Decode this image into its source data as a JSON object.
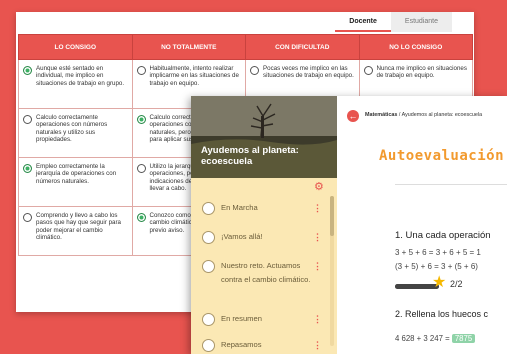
{
  "role_tabs": [
    "Docente",
    "Estudiante"
  ],
  "rubric": {
    "headers": [
      "Lo consigo",
      "No totalmente",
      "Con dificultad",
      "No lo consigo"
    ],
    "rows": [
      {
        "cells": [
          "Aunque esté sentado en individual, me implico en situaciones de trabajo en grupo.",
          "Habitualmente, intento realizar implicarme en las situaciones de trabajo en equipo.",
          "Pocas veces me implico en las situaciones de trabajo en equipo.",
          "Nunca me implico en situaciones de trabajo en equipo."
        ],
        "selected": 0
      },
      {
        "cells": [
          "Calculo correctamente operaciones con números naturales y utilizo sus propiedades.",
          "Calculo correctamente operaciones con números naturales, pero tengo dificultades para aplicar sus propiedades.",
          "",
          ""
        ],
        "selected": 1
      },
      {
        "cells": [
          "Empleo correctamente la jerarquía de operaciones con números naturales.",
          "Utilizo la jerarquía de operaciones, pero necesito indicaciones de lo que hay que llevar a cabo.",
          "",
          ""
        ],
        "selected": 0
      },
      {
        "cells": [
          "Comprendo y llevo a cabo los pasos que hay que seguir para poder mejorar el cambio climático.",
          "Conozco como poder mejorar el cambio climático, pero necesito previo aviso.",
          "",
          ""
        ],
        "selected": 1
      }
    ]
  },
  "app": {
    "hero_title": "Ayudemos al planeta: ecoescuela",
    "menu_items": [
      "En Marcha",
      "¡Vamos allá!",
      "Nuestro reto. Actuamos contra el cambio climático.",
      "En resumen",
      "Repasamos"
    ],
    "breadcrumb_subject": "Matemáticas",
    "breadcrumb_rest": " / Ayudemos al planeta: ecoescuela",
    "page_title": "Autoevaluación",
    "question1": "1. Una cada operación",
    "eq1": "3 + 5 + 6 = 3 + 6 + 5 = 1",
    "eq2": "(3 + 5) + 6 = 3 + (5 + 6)",
    "progress_value": 1.0,
    "score": "2/2",
    "question2": "2. Rellena los huecos c",
    "eq3_prefix": "4 628 + 3 247 =",
    "eq3_answer": "7875",
    "colors": {
      "accent": "#e8544f",
      "title": "#f29a2e",
      "menu_bg": "#fbe8b4",
      "selected_radio": "#3cb063"
    }
  }
}
